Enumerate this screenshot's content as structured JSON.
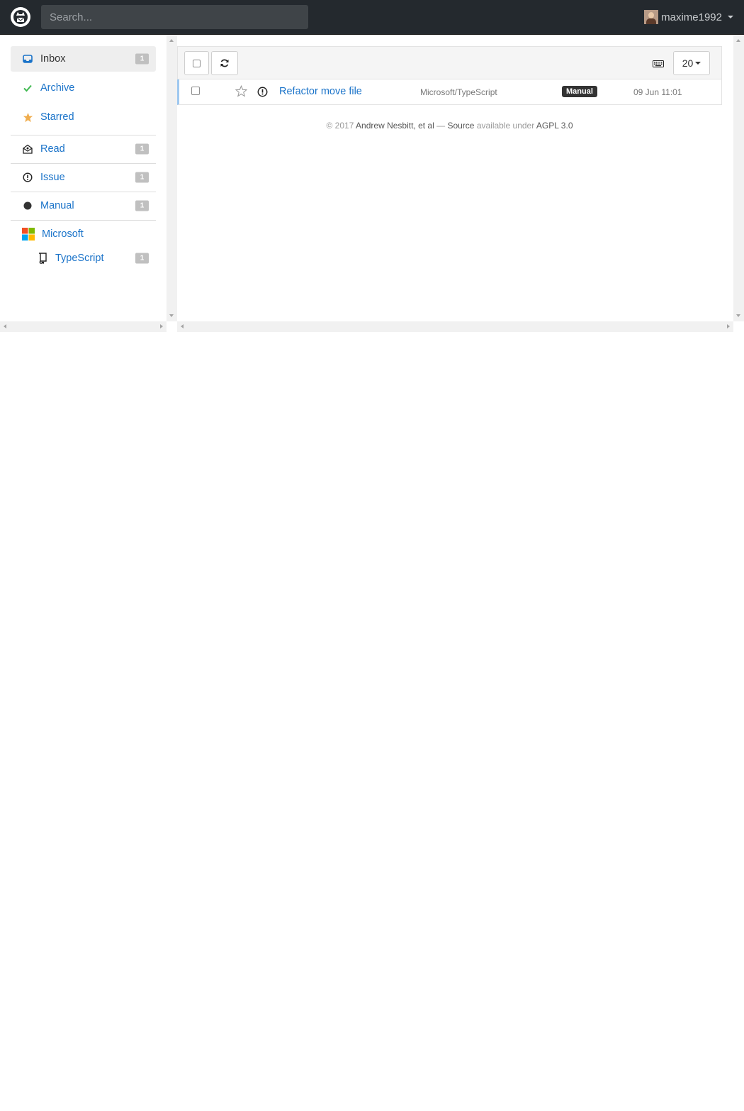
{
  "search": {
    "placeholder": "Search..."
  },
  "user": {
    "name": "maxime1992"
  },
  "sidebar": {
    "items": [
      {
        "label": "Inbox",
        "count": "1",
        "icon": "inbox-icon"
      },
      {
        "label": "Archive",
        "icon": "check-icon"
      },
      {
        "label": "Starred",
        "icon": "star-icon"
      },
      {
        "label": "Read",
        "count": "1",
        "icon": "envelope-open-icon"
      },
      {
        "label": "Issue",
        "count": "1",
        "icon": "issue-icon"
      },
      {
        "label": "Manual",
        "count": "1",
        "icon": "dot-icon"
      },
      {
        "label": "Microsoft",
        "icon": "microsoft-logo-icon"
      },
      {
        "label": "TypeScript",
        "count": "1",
        "icon": "repo-icon"
      }
    ]
  },
  "toolbar": {
    "per_page": "20"
  },
  "notifications": [
    {
      "title": "Refactor move file",
      "repo": "Microsoft/TypeScript",
      "reason": "Manual",
      "date": "09 Jun 11:01",
      "type_icon": "issue-icon"
    }
  ],
  "footer": {
    "copy": "© 2017",
    "author": "Andrew Nesbitt, et al",
    "dash": "—",
    "source": "Source",
    "available": "available under",
    "license": "AGPL 3.0"
  },
  "colors": {
    "navbar": "#24292e",
    "link": "#1a73c9",
    "archive_check": "#3fb950",
    "star": "#f0ad4e",
    "active_bg": "#eeeeee"
  }
}
